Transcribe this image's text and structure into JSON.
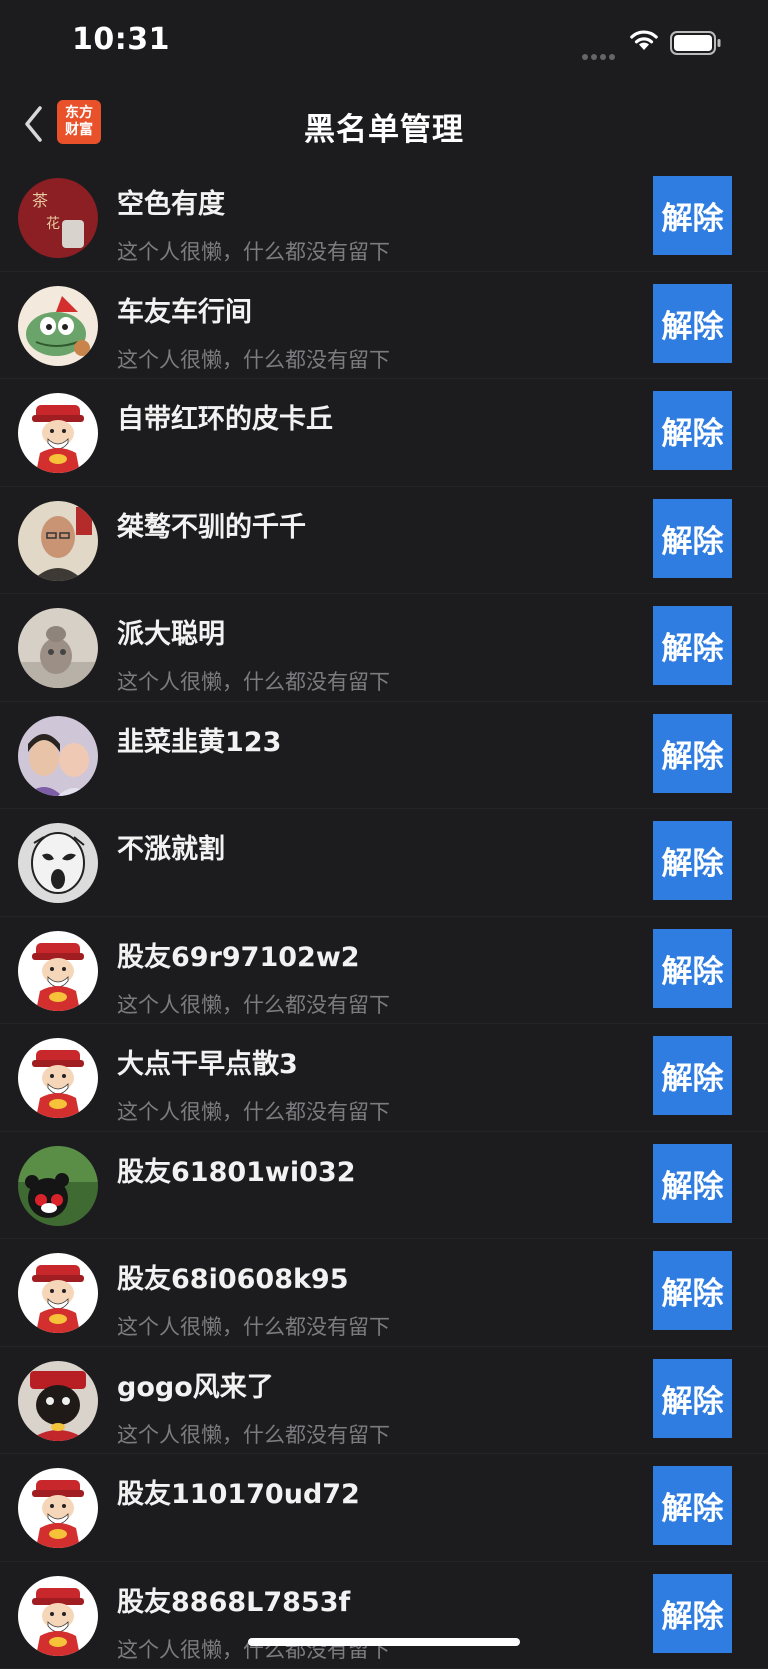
{
  "status": {
    "time": "10:31"
  },
  "header": {
    "title": "黑名单管理",
    "logo_line1": "东方",
    "logo_line2": "财富"
  },
  "unblock_label": "解除",
  "users": [
    {
      "name": "空色有度",
      "sig": "这个人很懒，什么都没有留下",
      "avatar": "photo-tea"
    },
    {
      "name": "车友车行间",
      "sig": "这个人很懒，什么都没有留下",
      "avatar": "crocodile-cartoon"
    },
    {
      "name": "自带红环的皮卡丘",
      "sig": "",
      "avatar": "god-of-wealth"
    },
    {
      "name": "桀骜不驯的千千",
      "sig": "",
      "avatar": "photo-man"
    },
    {
      "name": "派大聪明",
      "sig": "这个人很懒，什么都没有留下",
      "avatar": "photo-figurine"
    },
    {
      "name": "韭菜韭黄123",
      "sig": "",
      "avatar": "photo-mother-child"
    },
    {
      "name": "不涨就割",
      "sig": "",
      "avatar": "scream-sketch"
    },
    {
      "name": "股友69r97102w2",
      "sig": "这个人很懒，什么都没有留下",
      "avatar": "god-of-wealth"
    },
    {
      "name": "大点干早点散3",
      "sig": "这个人很懒，什么都没有留下",
      "avatar": "god-of-wealth"
    },
    {
      "name": "股友61801wi032",
      "sig": "",
      "avatar": "photo-kumamon"
    },
    {
      "name": "股友68i0608k95",
      "sig": "这个人很懒，什么都没有留下",
      "avatar": "god-of-wealth"
    },
    {
      "name": "gogo风来了",
      "sig": "这个人很懒，什么都没有留下",
      "avatar": "photo-dog"
    },
    {
      "name": "股友110170ud72",
      "sig": "",
      "avatar": "god-of-wealth"
    },
    {
      "name": "股友8868L7853f",
      "sig": "这个人很懒，什么都没有留下",
      "avatar": "god-of-wealth"
    }
  ]
}
